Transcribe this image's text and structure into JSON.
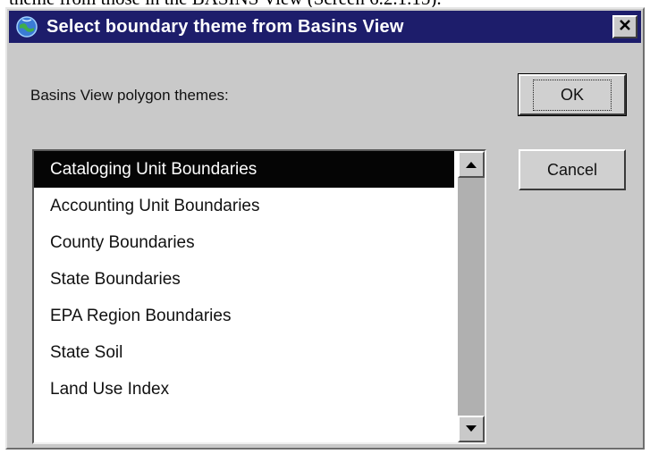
{
  "caption": {
    "text": "theme from those in the BASINS View (Screen 6.2.1.15)."
  },
  "window": {
    "title": "Select boundary theme from Basins View",
    "close_glyph": "✕"
  },
  "prompt": {
    "label": "Basins View polygon themes:"
  },
  "list": {
    "items": [
      {
        "label": "Cataloging Unit Boundaries",
        "selected": true
      },
      {
        "label": "Accounting Unit Boundaries"
      },
      {
        "label": "County Boundaries"
      },
      {
        "label": "State Boundaries"
      },
      {
        "label": "EPA Region Boundaries"
      },
      {
        "label": "State Soil"
      },
      {
        "label": "Land Use Index"
      }
    ]
  },
  "buttons": {
    "ok_label": "OK",
    "cancel_label": "Cancel"
  },
  "icons": {
    "app": "globe-icon",
    "close": "close-icon",
    "scroll_up": "arrow-up-icon",
    "scroll_down": "arrow-down-icon"
  },
  "colors": {
    "titlebar": "#1d1d6b",
    "dialog_face": "#c9c9c9",
    "selection": "#050505"
  }
}
